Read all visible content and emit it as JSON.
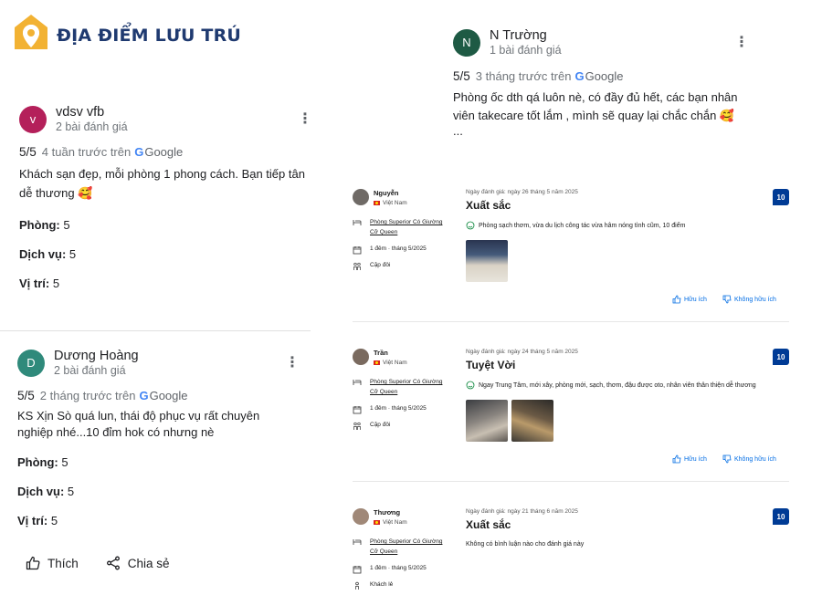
{
  "header": {
    "title": "ĐỊA ĐIỂM LƯU TRÚ"
  },
  "google_reviews": [
    {
      "initial": "v",
      "avatar_color": "#b4205a",
      "name": "vdsv vfb",
      "review_count": "2 bài đánh giá",
      "score": "5/5",
      "time": "4 tuần trước trên",
      "source": "Google",
      "text": "Khách sạn đẹp, mỗi phòng 1 phong cách. Bạn tiếp tân dễ thương 🥰",
      "attributes": [
        {
          "label": "Phòng:",
          "value": "5"
        },
        {
          "label": "Dịch vụ:",
          "value": "5"
        },
        {
          "label": "Vị trí:",
          "value": "5"
        }
      ]
    },
    {
      "initial": "D",
      "avatar_color": "#2f8a7b",
      "name": "Dương Hoàng",
      "review_count": "2 bài đánh giá",
      "score": "5/5",
      "time": "2 tháng trước trên",
      "source": "Google",
      "text": "KS Xịn Sò quá lun, thái độ phục vụ rất chuyên nghiệp nhé...10 đỉm hok có nhưng nè",
      "attributes": [
        {
          "label": "Phòng:",
          "value": "5"
        },
        {
          "label": "Dịch vụ:",
          "value": "5"
        },
        {
          "label": "Vị trí:",
          "value": "5"
        }
      ]
    },
    {
      "initial": "N",
      "avatar_color": "#1e5a44",
      "name": "N Trường",
      "review_count": "1 bài đánh giá",
      "score": "5/5",
      "time": "3 tháng trước trên",
      "source": "Google",
      "text": "Phòng ốc dth qá luôn nè, có đầy đủ hết, các bạn nhân viên takecare tốt lắm , mình sẽ quay lại chắc chắn 🥰",
      "more": "..."
    }
  ],
  "actions": {
    "like": "Thích",
    "share": "Chia sẻ"
  },
  "booking_reviews": [
    {
      "name": "Nguyễn",
      "country": "Việt Nam",
      "room": "Phòng Superior Có Giường Cỡ Queen",
      "stay": "1 đêm · tháng 5/2025",
      "traveler": "Cặp đôi",
      "date": "Ngày đánh giá: ngày 26 tháng 5 năm 2025",
      "title": "Xuất sắc",
      "score": "10",
      "comment": "Phòng sạch thơm, vừa du lịch công tác vừa hâm nóng tình cũm, 10 điểm",
      "helpful": "Hữu ích",
      "not_helpful": "Không hữu ích"
    },
    {
      "name": "Trần",
      "country": "Việt Nam",
      "room": "Phòng Superior Có Giường Cỡ Queen",
      "stay": "1 đêm · tháng 5/2025",
      "traveler": "Cặp đôi",
      "date": "Ngày đánh giá: ngày 24 tháng 5 năm 2025",
      "title": "Tuyệt Vời",
      "score": "10",
      "comment": "Ngay Trung Tâm, mới xây, phòng mới, sạch, thơm, đậu được oto, nhân viên thân thiện dễ thương",
      "helpful": "Hữu ích",
      "not_helpful": "Không hữu ích"
    },
    {
      "name": "Thương",
      "country": "Việt Nam",
      "room": "Phòng Superior Có Giường Cỡ Queen",
      "stay": "1 đêm · tháng 5/2025",
      "traveler": "Khách lẻ",
      "date": "Ngày đánh giá: ngày 21 tháng 6 năm 2025",
      "title": "Xuất sắc",
      "score": "10",
      "comment": "Không có bình luận nào cho đánh giá này"
    }
  ]
}
